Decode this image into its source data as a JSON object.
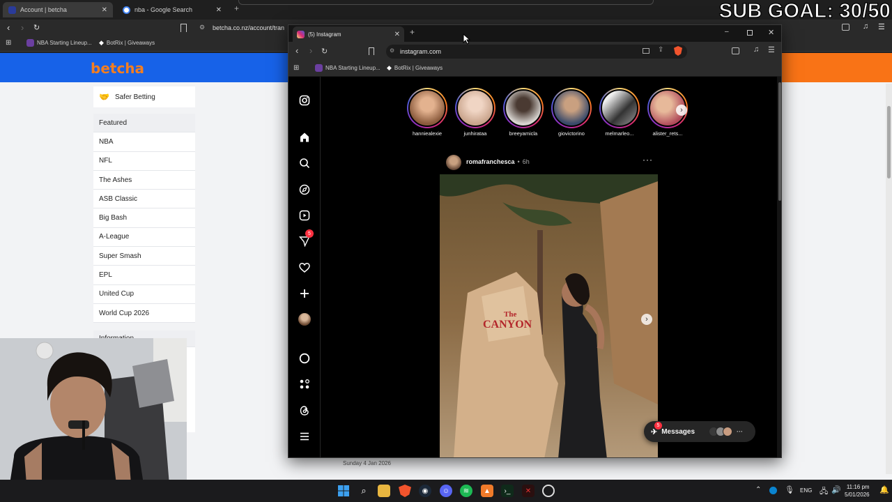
{
  "overlay": {
    "sub_goal": "SUB GOAL: 30/50"
  },
  "back_browser": {
    "tabs": [
      {
        "title": "Account | betcha"
      },
      {
        "title": "nba - Google Search"
      }
    ],
    "url": "betcha.co.nz/account/tran",
    "bookmarks": [
      {
        "label": "NBA Starting Lineup..."
      },
      {
        "label": "BotRix | Giveaways"
      }
    ]
  },
  "betcha": {
    "logo": "betcha",
    "safer_betting": "Safer Betting",
    "featured_header": "Featured",
    "featured_items": [
      "NBA",
      "NFL",
      "The Ashes",
      "ASB Classic",
      "Big Bash",
      "A-League",
      "Super Smash",
      "EPL",
      "United Cup",
      "World Cup 2026"
    ],
    "information_header": "Information",
    "date_label": "Sunday 4 Jan 2026"
  },
  "ig_browser": {
    "tab_title": "(5) Instagram",
    "url": "instagram.com",
    "bookmarks": [
      {
        "label": "NBA Starting Lineup..."
      },
      {
        "label": "BotRix | Giveaways"
      }
    ]
  },
  "instagram": {
    "nav_icons": [
      "instagram-logo-icon",
      "home-icon",
      "search-icon",
      "explore-icon",
      "reels-icon",
      "messages-icon",
      "notifications-icon",
      "create-icon",
      "profile-icon",
      "meta-ai-icon",
      "also-from-meta-icon",
      "threads-icon",
      "more-icon"
    ],
    "messages_badge": "5",
    "stories": [
      {
        "username": "hanniealexie",
        "color": "#8a5a3c"
      },
      {
        "username": "junhirataa",
        "color": "#c9a48c"
      },
      {
        "username": "breeyamicla",
        "color": "#d8d4d0"
      },
      {
        "username": "giovictorino",
        "color": "#3a4a6a"
      },
      {
        "username": "melmarleo...",
        "color": "#6a6a6a"
      },
      {
        "username": "alister_rets...",
        "color": "#b04a5a"
      }
    ],
    "post": {
      "username": "romafranchesca",
      "separator": "•",
      "time": "6h",
      "photo_sign_line1": "The",
      "photo_sign_line2": "CANYON"
    },
    "messages_pill": {
      "label": "Messages",
      "badge": "5",
      "more": "···"
    }
  },
  "taskbar": {
    "language": "ENG",
    "time": "11:16 pm",
    "date": "5/01/2026",
    "icons": [
      "windows-start-icon",
      "search-icon",
      "file-explorer-icon",
      "brave-icon",
      "steam-icon",
      "discord-icon",
      "spotify-icon",
      "app-icon",
      "terminal-icon",
      "app-x-icon",
      "obs-icon"
    ]
  }
}
